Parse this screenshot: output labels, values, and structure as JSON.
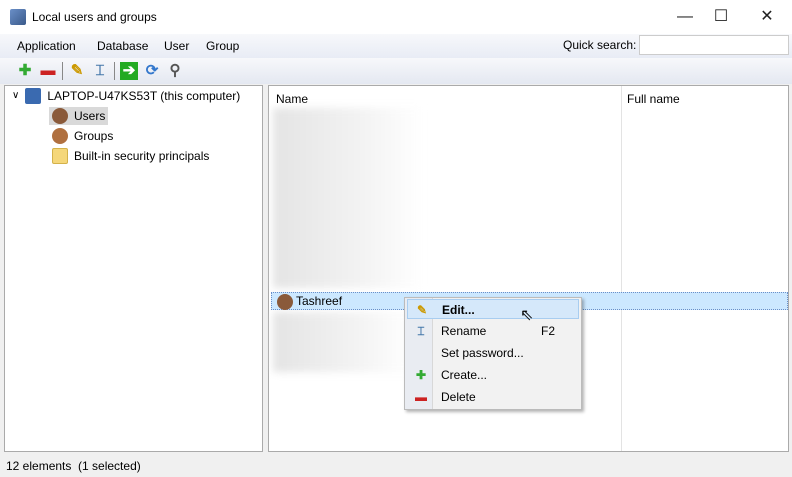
{
  "window": {
    "title": "Local users and groups",
    "minimize": "—",
    "maximize": "☐",
    "close": "✕"
  },
  "menu": [
    "Application",
    "Database",
    "User",
    "Group"
  ],
  "quick_search": {
    "label": "Quick search:",
    "value": ""
  },
  "tree": {
    "root": "LAPTOP-U47KS53T (this computer)",
    "items": [
      "Users",
      "Groups",
      "Built-in security principals"
    ]
  },
  "list": {
    "columns": [
      "Name",
      "Full name"
    ],
    "selected_row": "Tashreef"
  },
  "context_menu": [
    {
      "label": "Edit...",
      "shortcut": ""
    },
    {
      "label": "Rename",
      "shortcut": "F2"
    },
    {
      "label": "Set password...",
      "shortcut": ""
    },
    {
      "label": "Create...",
      "shortcut": ""
    },
    {
      "label": "Delete",
      "shortcut": ""
    }
  ],
  "status": "12 elements  (1 selected)"
}
